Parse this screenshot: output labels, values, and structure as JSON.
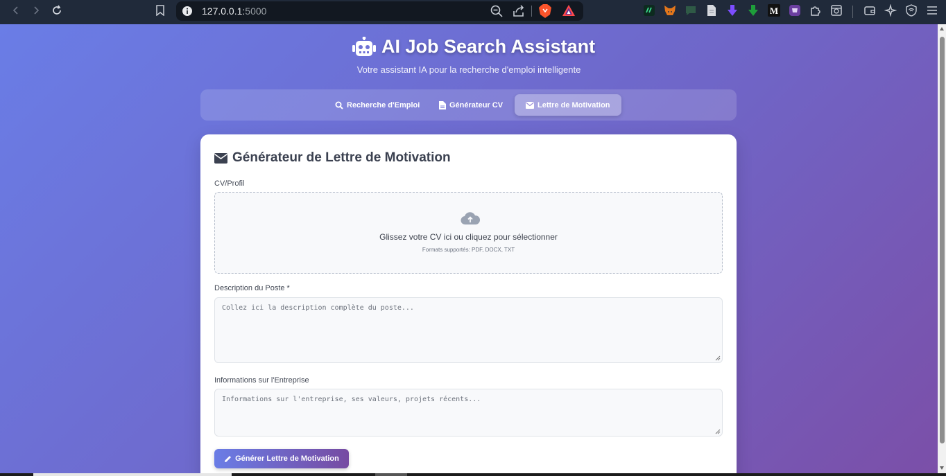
{
  "browser": {
    "url_host": "127.0.0.1:",
    "url_port": "5000"
  },
  "app": {
    "title": "AI Job Search Assistant",
    "subtitle": "Votre assistant IA pour la recherche d'emploi intelligente",
    "icon": "robot-icon"
  },
  "tabs": [
    {
      "label": "Recherche d'Emploi",
      "icon": "search-icon",
      "active": false
    },
    {
      "label": "Générateur CV",
      "icon": "file-icon",
      "active": false
    },
    {
      "label": "Lettre de Motivation",
      "icon": "envelope-icon",
      "active": true
    }
  ],
  "card": {
    "title": "Générateur de Lettre de Motivation",
    "icon": "envelope-icon"
  },
  "form": {
    "cv_label": "CV/Profil",
    "dropzone_text": "Glissez votre CV ici ou cliquez pour sélectionner",
    "dropzone_formats": "Formats supportés: PDF, DOCX, TXT",
    "desc_label": "Description du Poste *",
    "desc_placeholder": "Collez ici la description complète du poste...",
    "company_label": "Informations sur l'Entreprise",
    "company_placeholder": "Informations sur l'entreprise, ses valeurs, projets récents...",
    "generate_label": "Générer Lettre de Motivation"
  },
  "colors": {
    "gradient_start": "#6a7de6",
    "gradient_end": "#764ba2",
    "browser_bar": "#202a3a"
  }
}
